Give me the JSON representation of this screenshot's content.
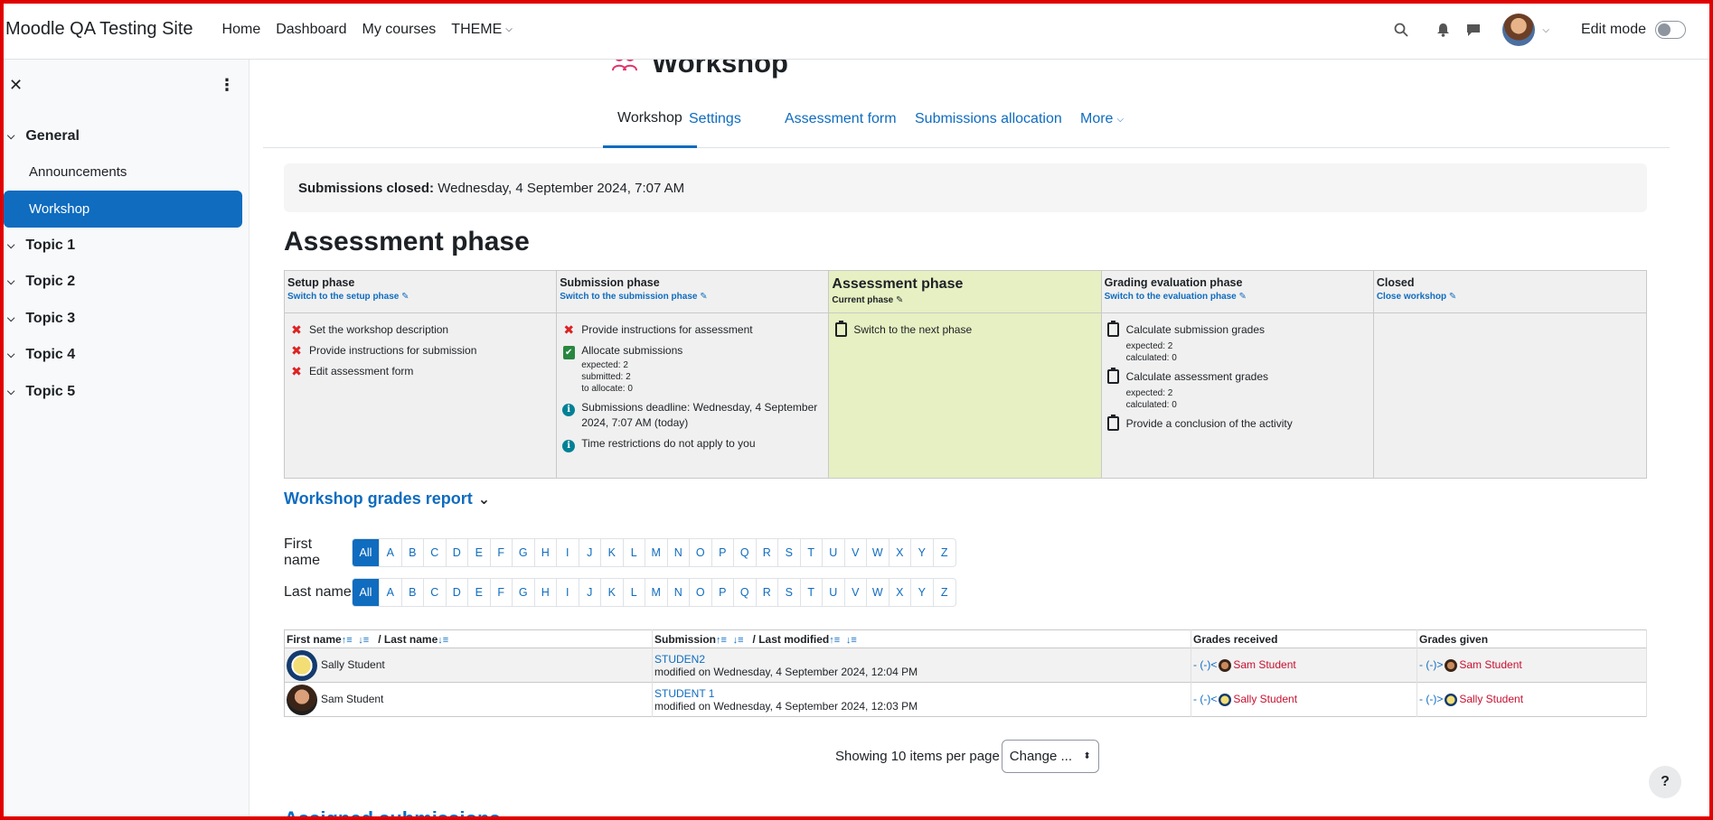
{
  "navbar": {
    "site_name": "Moodle QA Testing Site",
    "nav_items": [
      "Home",
      "Dashboard",
      "My courses",
      "THEME"
    ],
    "edit_mode_label": "Edit mode"
  },
  "sidebar": {
    "close_symbol": "✕",
    "menu_symbol": "⋮",
    "sections": [
      {
        "label": "General",
        "items": [
          "Announcements",
          "Workshop"
        ]
      },
      {
        "label": "Topic 1"
      },
      {
        "label": "Topic 2"
      },
      {
        "label": "Topic 3"
      },
      {
        "label": "Topic 4"
      },
      {
        "label": "Topic 5"
      }
    ],
    "active_item": "Workshop"
  },
  "page": {
    "title": "Workshop",
    "tabs": [
      "Workshop",
      "Settings",
      "Assessment form",
      "Submissions allocation",
      "More"
    ],
    "closed_label": "Submissions closed:",
    "closed_value": "Wednesday, 4 September 2024, 7:07 AM",
    "phase_heading": "Assessment phase"
  },
  "phases": [
    {
      "name": "Setup phase",
      "link": "Switch to the setup phase",
      "tasks": [
        "Set the workshop description",
        "Provide instructions for submission",
        "Edit assessment form"
      ]
    },
    {
      "name": "Submission phase",
      "link": "Switch to the submission phase",
      "tasks": [
        "Provide instructions for assessment",
        "Allocate submissions",
        "Submissions deadline: Wednesday, 4 September 2024, 7:07 AM (today)",
        "Time restrictions do not apply to you"
      ],
      "alloc_details": [
        "expected: 2",
        "submitted: 2",
        "to allocate: 0"
      ]
    },
    {
      "name": "Assessment phase",
      "link": "Current phase",
      "tasks": [
        "Switch to the next phase"
      ]
    },
    {
      "name": "Grading evaluation phase",
      "link": "Switch to the evaluation phase",
      "tasks": [
        "Calculate submission grades",
        "Calculate assessment grades",
        "Provide a conclusion of the activity"
      ],
      "sub_details": [
        "expected: 2",
        "calculated: 0"
      ],
      "asm_details": [
        "expected: 2",
        "calculated: 0"
      ]
    },
    {
      "name": "Closed",
      "link": "Close workshop",
      "tasks": []
    }
  ],
  "grades_report": {
    "title": "Workshop grades report",
    "first_name_label": "First name",
    "last_name_label": "Last name",
    "all_label": "All",
    "letters": [
      "A",
      "B",
      "C",
      "D",
      "E",
      "F",
      "G",
      "H",
      "I",
      "J",
      "K",
      "L",
      "M",
      "N",
      "O",
      "P",
      "Q",
      "R",
      "S",
      "T",
      "U",
      "V",
      "W",
      "X",
      "Y",
      "Z"
    ],
    "columns": {
      "first_name": "First name",
      "last_name": "/ Last name",
      "submission": "Submission",
      "last_modified": "/ Last modified",
      "received": "Grades received",
      "given": "Grades given"
    },
    "rows": [
      {
        "name": "Sally Student",
        "submission": "STUDEN2",
        "modified": "modified on Wednesday, 4 September 2024, 12:04 PM",
        "received_prefix": "- (-)<",
        "received_name": "Sam Student",
        "given_prefix": "- (-)>",
        "given_name": "Sam Student"
      },
      {
        "name": "Sam Student",
        "submission": "STUDENT 1",
        "modified": "modified on Wednesday, 4 September 2024, 12:03 PM",
        "received_prefix": "- (-)<",
        "received_name": "Sally Student",
        "given_prefix": "- (-)>",
        "given_name": "Sally Student"
      }
    ],
    "paging_text": "Showing 10 items per page",
    "perpage_value": "Change ..."
  },
  "next_section": "Assigned submissions",
  "help_label": "?"
}
